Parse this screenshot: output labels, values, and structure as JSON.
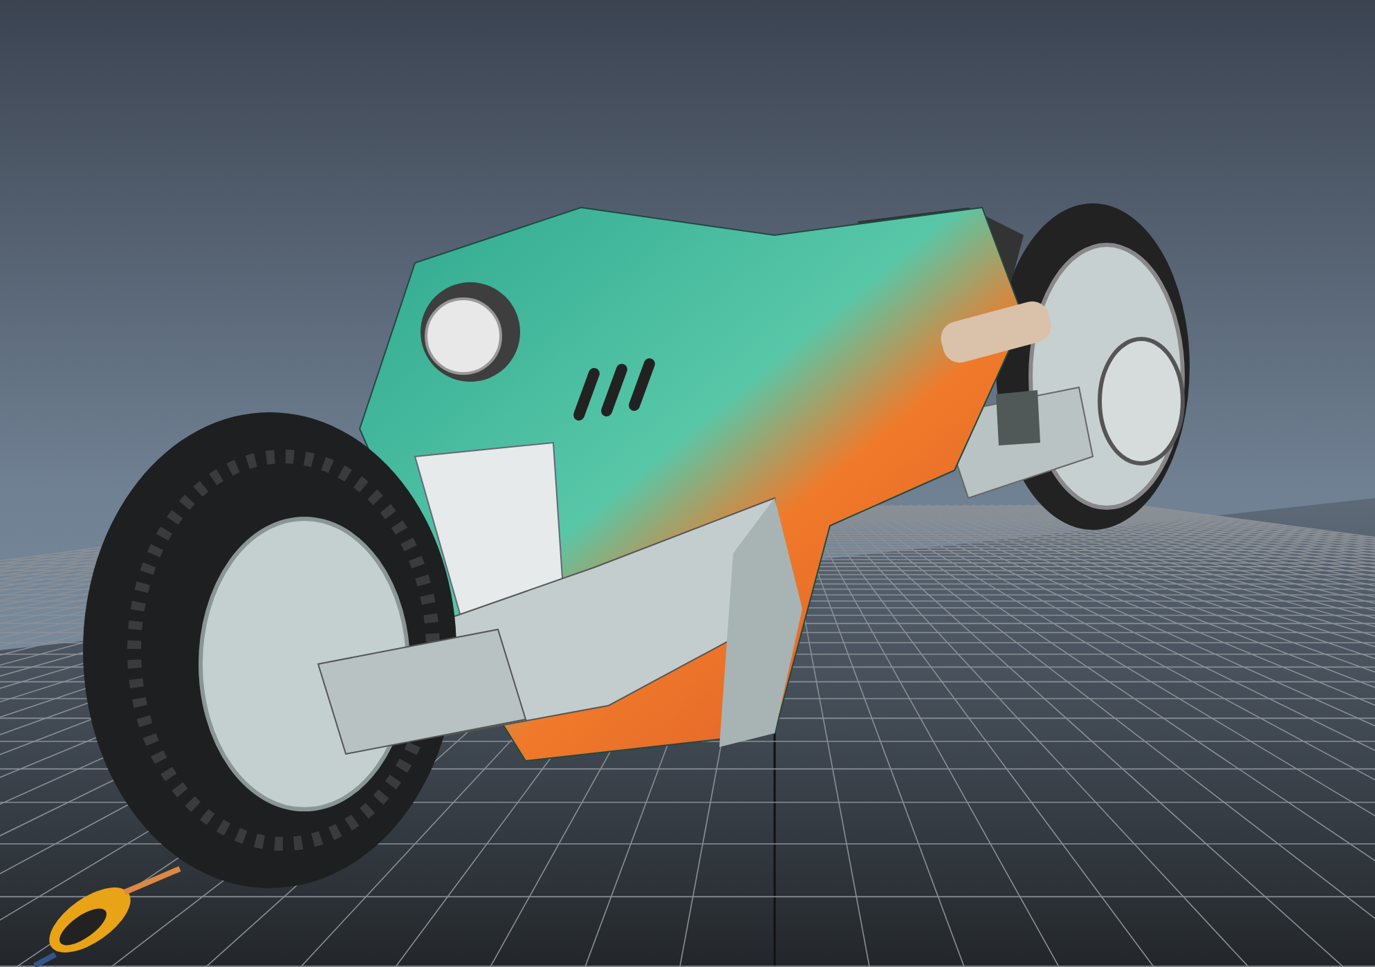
{
  "viewport": {
    "show_grid": true,
    "show_axis_gizmo": true
  }
}
